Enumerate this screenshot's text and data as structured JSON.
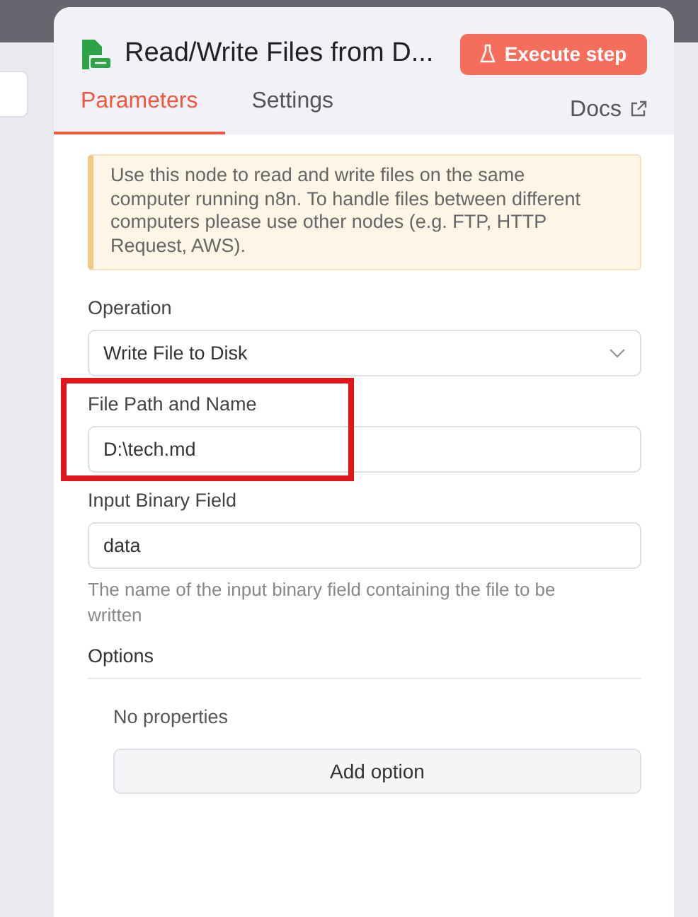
{
  "header": {
    "title": "Read/Write Files from D...",
    "execute_button": "Execute step"
  },
  "tabs": [
    {
      "label": "Parameters",
      "selected": true
    },
    {
      "label": "Settings",
      "selected": false
    }
  ],
  "docs_link": "Docs",
  "notice": "Use this node to read and write files on the same computer running n8n. To handle files between different computers please use other nodes (e.g. FTP, HTTP Request, AWS).",
  "fields": [
    {
      "kind": "select",
      "label": "Operation",
      "value": "Write File to Disk",
      "highlighted": false
    },
    {
      "kind": "text",
      "label": "File Path and Name",
      "value": "D:\\tech.md",
      "highlighted": true
    },
    {
      "kind": "text",
      "label": "Input Binary Field",
      "value": "data",
      "hint": "The name of the input binary field containing the file to be written",
      "highlighted": false
    }
  ],
  "options": {
    "label": "Options",
    "empty_text": "No properties",
    "add_button": "Add option"
  }
}
